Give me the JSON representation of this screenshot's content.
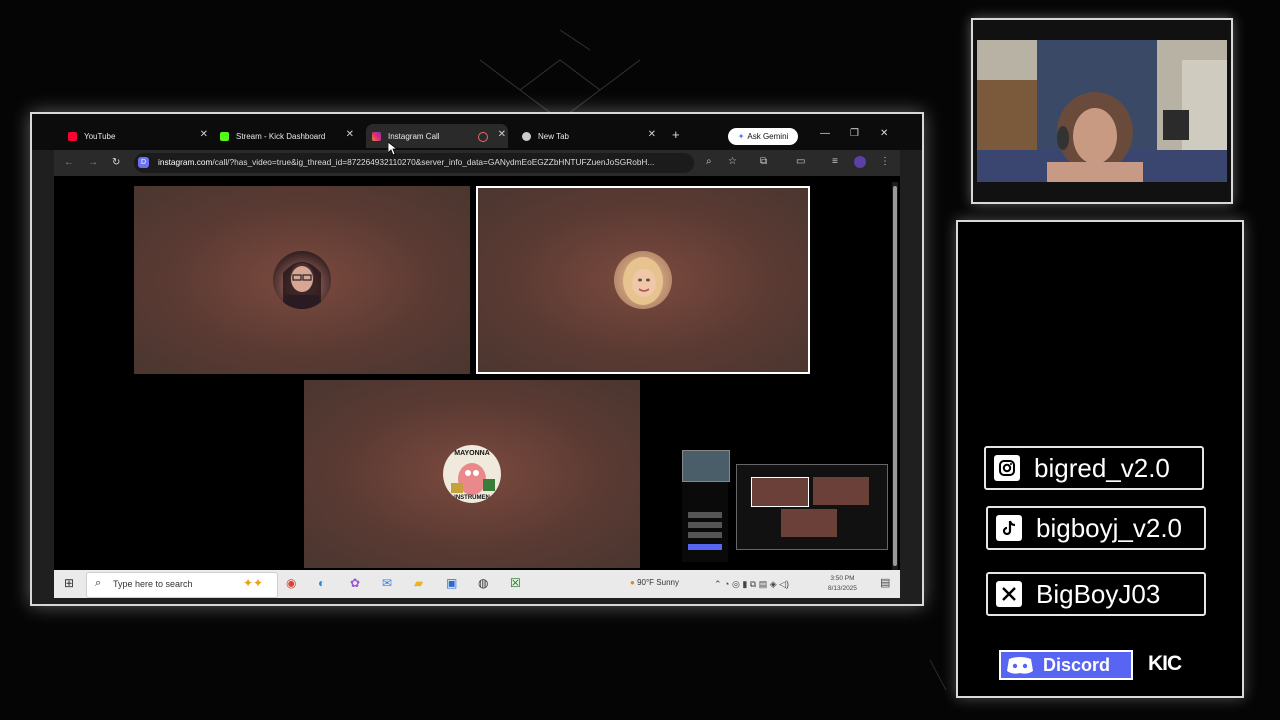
{
  "browser": {
    "tabs": [
      {
        "label": "YouTube",
        "icon": "youtube-icon",
        "color": "#ff0033"
      },
      {
        "label": "Stream - Kick Dashboard",
        "icon": "kick-icon",
        "color": "#53fc18"
      },
      {
        "label": "Instagram Call",
        "icon": "instagram-icon",
        "color": "#e1306c",
        "active": true
      },
      {
        "label": "New Tab",
        "icon": "chrome-icon",
        "color": "#cccccc"
      }
    ],
    "new_tab_symbol": "+",
    "gemini_label": "Ask Gemini",
    "address": {
      "host": "instagram.com",
      "path": "/call/?has_video=true&ig_thread_id=872264932110270&server_info_data=GANydmEoEGZZbHNTUFZuenJoSGRobH..."
    }
  },
  "call": {
    "participants": [
      {
        "name": "participant-1",
        "avatar": "glasses-woman"
      },
      {
        "name": "participant-2",
        "avatar": "blonde-woman",
        "selected": true
      },
      {
        "name": "participant-3",
        "avatar": "mayonnaise-instrument"
      }
    ],
    "avatar_text": {
      "top": "MAYONNA",
      "bottom": "INSTRUMEN"
    }
  },
  "taskbar": {
    "search_placeholder": "Type here to search",
    "weather": "90°F  Sunny",
    "time": "3:50 PM",
    "date": "8/13/2025"
  },
  "overlay": {
    "socials": [
      {
        "icon": "instagram-icon",
        "handle": "bigred_v2.0"
      },
      {
        "icon": "tiktok-icon",
        "handle": "bigboyj_v2.0"
      },
      {
        "icon": "x-icon",
        "handle": "BigBoyJ03"
      }
    ],
    "discord_label": "Discord",
    "kick_label": "KIC"
  },
  "colors": {
    "accent_instagram": "#e1306c",
    "discord": "#5865f2",
    "tile": "#6b4039"
  }
}
